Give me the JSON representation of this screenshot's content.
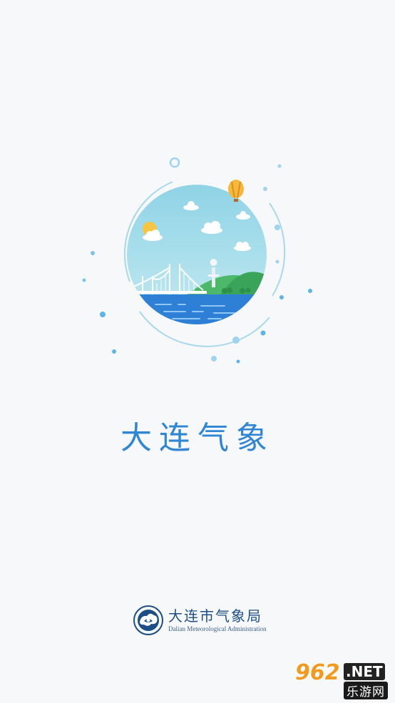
{
  "app": {
    "title": "大连气象"
  },
  "org": {
    "name": "大连市气象局",
    "name_en": "Dalian Meteorological Administration",
    "logo_icon": "meteorological-cloud-emblem-icon"
  },
  "splash": {
    "illustration_icon": "dalian-scenery-bridge-balloon-icon"
  },
  "watermark": {
    "number": "962",
    "domain": ".NET",
    "site_name": "乐游网"
  },
  "colors": {
    "accent": "#2f86d4",
    "background": "#f7f8fa",
    "org_text": "#1d4e86"
  }
}
